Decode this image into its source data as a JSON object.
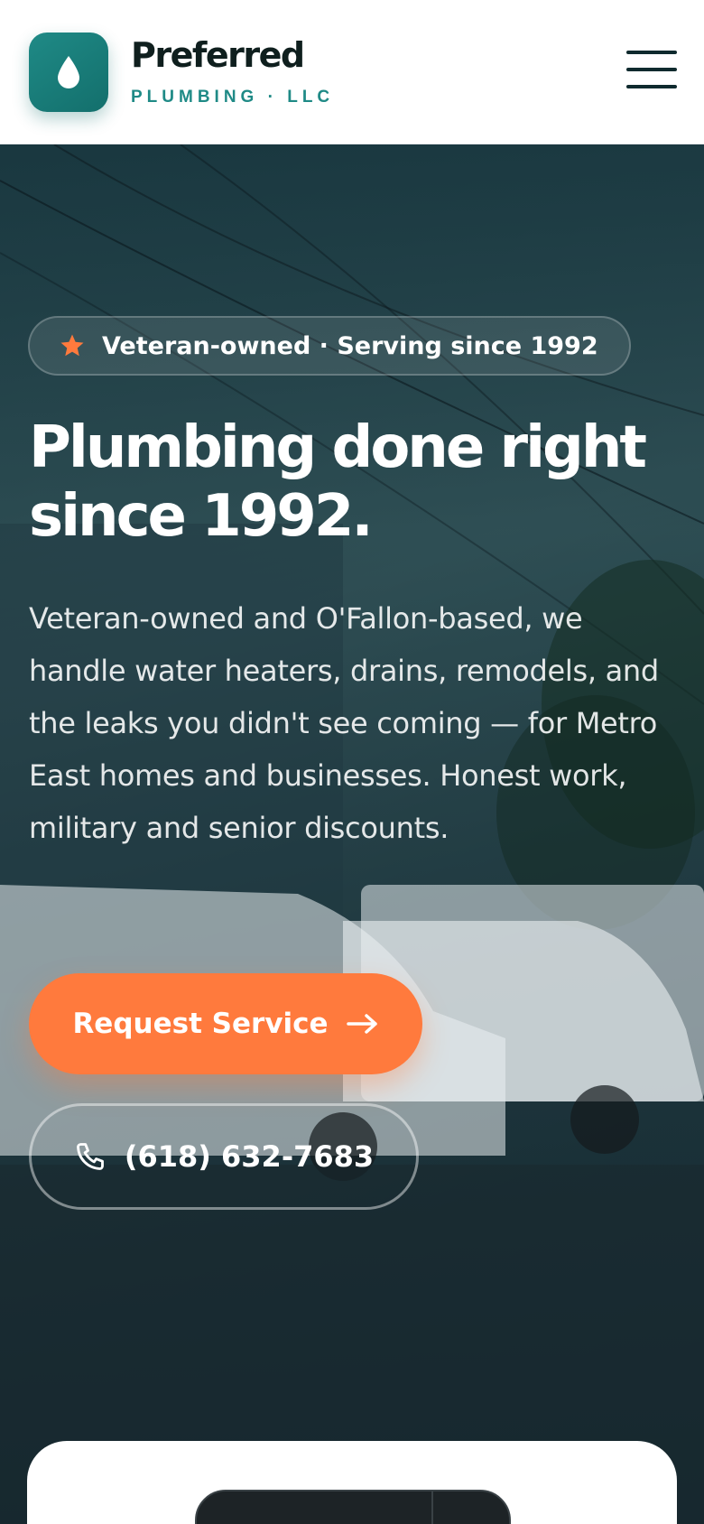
{
  "header": {
    "brand_name": "Preferred",
    "brand_sub": "PLUMBING · LLC",
    "logo_icon": "water-drop-icon",
    "menu_icon": "hamburger-menu-icon"
  },
  "hero": {
    "badge_text": "Veteran-owned · Serving since 1992",
    "badge_icon": "star-icon",
    "title": "Plumbing done right since 1992.",
    "body": "Veteran-owned and O'Fallon-based, we handle water heaters, drains, remodels, and the leaks you didn't see coming — for Metro East homes and businesses. Honest work, military and senior discounts.",
    "primary_cta": "Request Service",
    "primary_cta_icon": "arrow-right-icon",
    "phone_cta": "(618) 632-7683",
    "phone_icon": "phone-icon"
  },
  "colors": {
    "brand_teal": "#1f8a86",
    "accent_orange": "#ff7a3d",
    "ink": "#0f1f1e"
  }
}
